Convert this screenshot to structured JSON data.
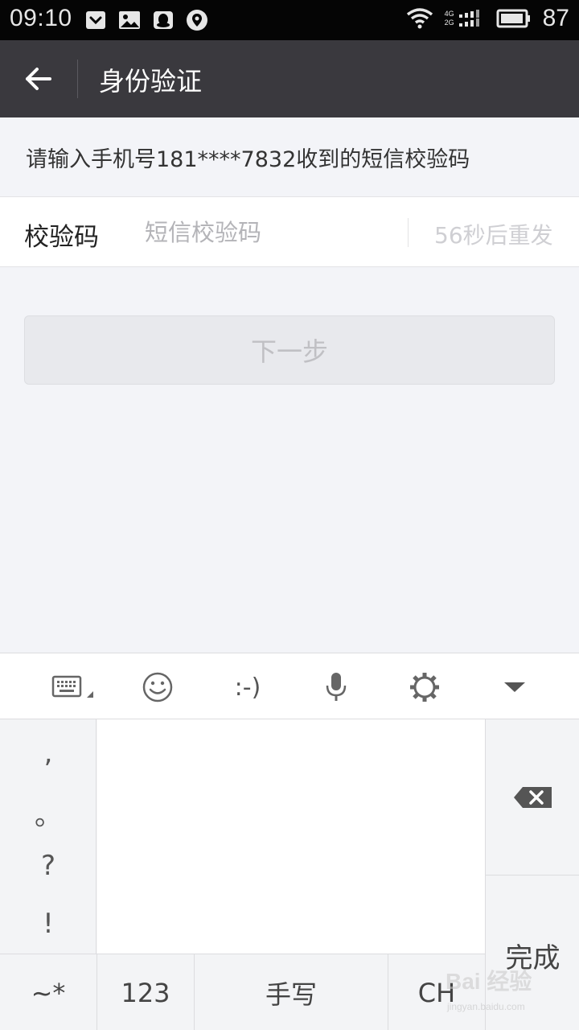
{
  "status_bar": {
    "time": "09:10",
    "left_icons": [
      "pocket-icon",
      "image-icon",
      "qq-icon",
      "location-icon"
    ],
    "network_top": "4G",
    "network_bottom": "2G",
    "battery_level": "87"
  },
  "header": {
    "title": "身份验证",
    "back_icon": "arrow-left-icon"
  },
  "instruction": "请输入手机号181****7832收到的短信校验码",
  "code_field": {
    "label": "校验码",
    "placeholder": "短信校验码",
    "value": "",
    "resend_label": "56秒后重发"
  },
  "next_button": {
    "label": "下一步",
    "enabled": false
  },
  "keyboard": {
    "toolbar": {
      "keyboard_switch_icon": "keyboard-icon",
      "emoji_icon": "smiley-icon",
      "emoticon": ":-)",
      "voice_icon": "microphone-icon",
      "settings_icon": "gear-icon",
      "hide_icon": "triangle-down-icon"
    },
    "punctuation": [
      ",",
      "。",
      "?",
      "!"
    ],
    "bottom_keys": {
      "symbols": "~*",
      "numbers": "123",
      "handwriting": "手写",
      "lang": "CH"
    },
    "delete_icon": "backspace-icon",
    "done_label": "完成"
  },
  "watermark": {
    "main": "Bai 经验",
    "sub": "jingyan.baidu.com"
  },
  "colors": {
    "header_bg": "#3a393e",
    "page_bg": "#f3f4f8",
    "disabled_text": "#c0c0c4"
  }
}
